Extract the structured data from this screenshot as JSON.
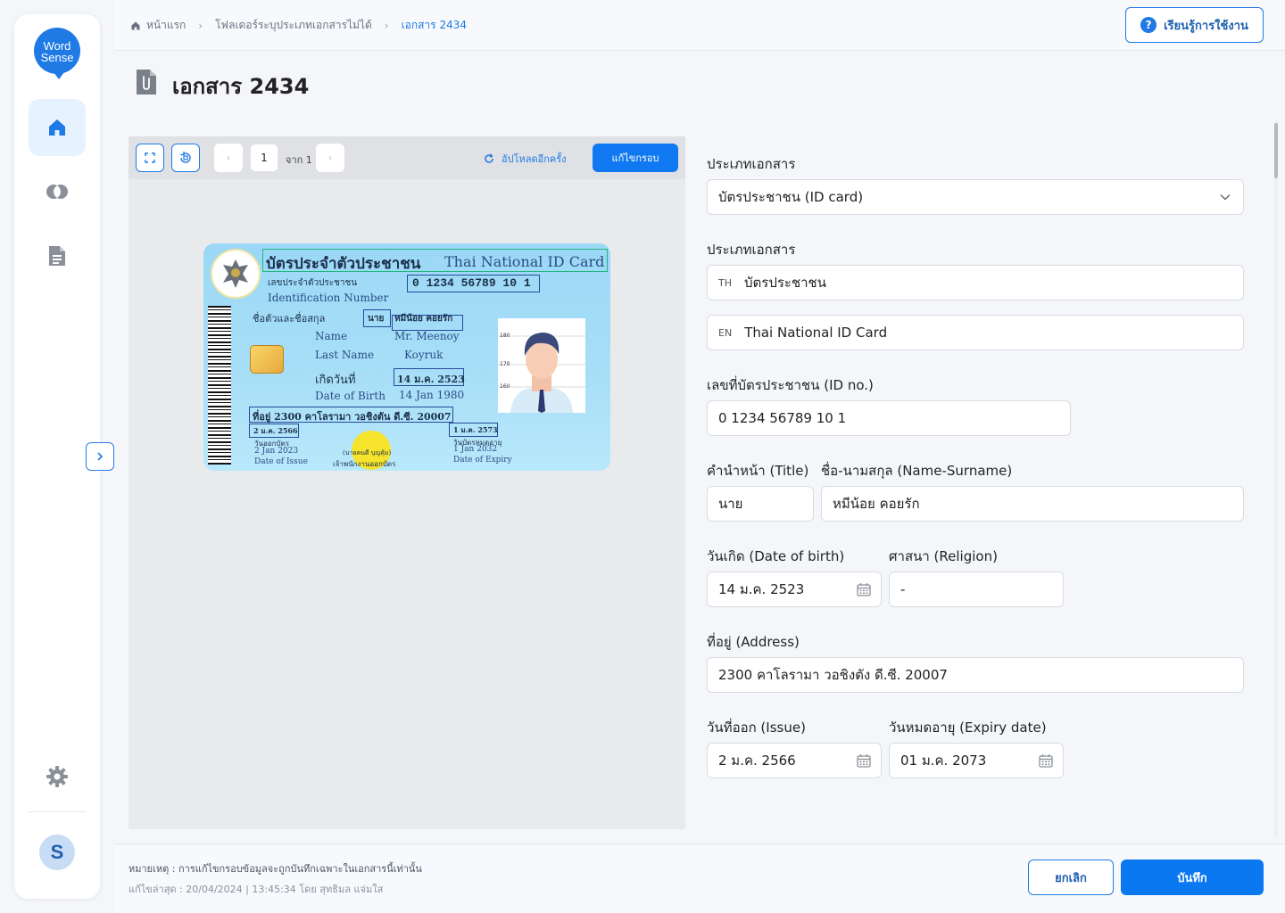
{
  "app": {
    "logo_line1": "Word",
    "logo_line2": "Sense",
    "user_initial": "S"
  },
  "colors": {
    "primary": "#1078f0",
    "accent_light": "#e7f2ff",
    "sidebar_bg": "#ffffff",
    "page_bg": "#f4f6f9"
  },
  "sidebar": {
    "items": [
      {
        "name": "home",
        "icon": "home-icon",
        "active": true
      },
      {
        "name": "compare",
        "icon": "overlap-circles-icon",
        "active": false
      },
      {
        "name": "documents",
        "icon": "document-icon",
        "active": false
      }
    ],
    "settings_icon": "gear-icon",
    "collapse_icon": "chevron-right-icon"
  },
  "breadcrumb": {
    "home": "หน้าแรก",
    "folder": "โฟลเดอร์ระบุประเภทเอกสารไม่ได้",
    "current": "เอกสาร 2434"
  },
  "help_button": "เรียนรู้การใช้งาน",
  "page_title": "เอกสาร 2434",
  "viewer": {
    "page_number": "1",
    "page_of": "จาก 1",
    "reupload": "อัปโหลดอีกครั้ง",
    "edit_frame": "แก้ไขกรอบ"
  },
  "idcard": {
    "title_th": "บัตรประจำตัวประชาชน",
    "title_en": "Thai National ID Card",
    "id_label_th": "เลขประจำตัวประชาชน",
    "id_label_en": "Identification Number",
    "id_number": "0 1234 56789 10 1",
    "name_label_th": "ชื่อตัวและชื่อสกุล",
    "prefix_th": "นาย",
    "name_th": "หมีน้อย คอยรัก",
    "name_label_en": "Name",
    "name_en": "Mr. Meenoy",
    "lastname_label_en": "Last Name",
    "lastname_en": "Koyruk",
    "dob_label_th": "เกิดวันที่",
    "dob_th": "14 ม.ค. 2523",
    "dob_label_en": "Date of Birth",
    "dob_en": "14 Jan 1980",
    "address": "ที่อยู่ 2300 คาโลรามา วอชิงตัน ดี.ซี. 20007",
    "issue_th": "2 ม.ค. 2566",
    "issue_label_th": "วันออกบัตร",
    "issue_en": "2 Jan 2023",
    "issue_label_en": "Date of Issue",
    "officer_name": "(นายคนดี บุญคุ้ม)",
    "officer_label": "เจ้าพนักงานออกบัตร",
    "expiry_th": "1 ม.ค. 2573",
    "expiry_label_th": "วันบัตรหมดอายุ",
    "expiry_en": "1 Jan 2032",
    "expiry_label_en": "Date of Expiry",
    "ruler_180": "180",
    "ruler_170": "170",
    "ruler_160": "160"
  },
  "form": {
    "doc_type_label": "ประเภทเอกสาร",
    "doc_type_value": "บัตรประชาชน (ID card)",
    "doc_name_label": "ประเภทเอกสาร",
    "th_prefix": "TH",
    "th_value": "บัตรประชาชน",
    "en_prefix": "EN",
    "en_value": "Thai National ID Card",
    "id_label": "เลขที่บัตรประชาชน (ID no.)",
    "id_value": "0 1234 56789 10 1",
    "title_label": "คำนำหน้า (Title)",
    "title_value": "นาย",
    "name_label": "ชื่อ-นามสกุล (Name-Surname)",
    "name_value": "หมีน้อย คอยรัก",
    "dob_label": "วันเกิด (Date of birth)",
    "dob_value": "14 ม.ค. 2523",
    "religion_label": "ศาสนา (Religion)",
    "religion_value": "-",
    "address_label": "ที่อยู่ (Address)",
    "address_value": "2300 คาโลรามา วอชิงตัง ดี.ซี. 20007",
    "issue_label": "วันที่ออก (Issue)",
    "issue_value": "2 ม.ค. 2566",
    "expiry_label": "วันหมดอายุ (Expiry date)",
    "expiry_value": "01 ม.ค. 2073"
  },
  "footer": {
    "note": "หมายเหตุ : การแก้ไขกรอบข้อมูลจะถูกบันทึกเฉพาะในเอกสารนี้เท่านั้น",
    "updated": "แก้ไขล่าสุด : 20/04/2024 | 13:45:34 โดย สุทธิมล แจ่มใส",
    "cancel": "ยกเลิก",
    "save": "บันทึก"
  }
}
